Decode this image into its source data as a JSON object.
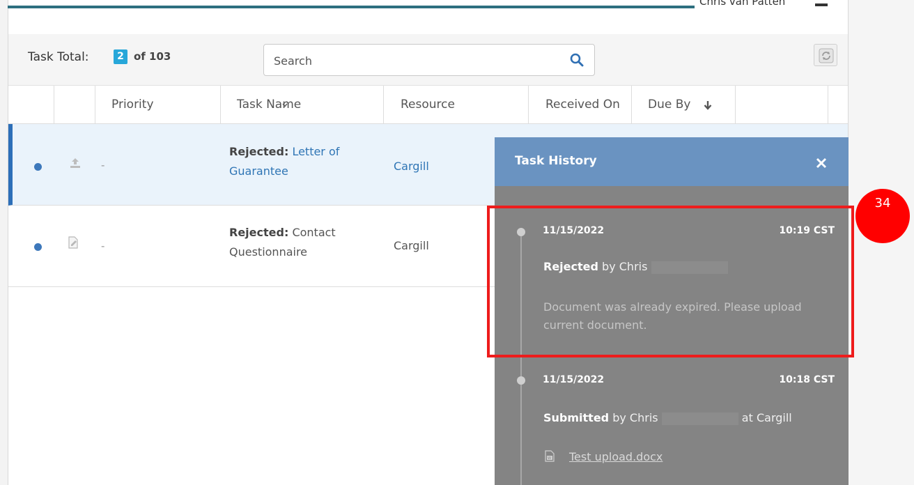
{
  "header": {
    "user_name": "Chris van Patten"
  },
  "toolbar": {
    "task_total_label": "Task Total:",
    "task_count": "2",
    "task_of_label": "of 103",
    "search_placeholder": "Search"
  },
  "table": {
    "columns": {
      "priority": "Priority",
      "task_name": "Task Name",
      "resource": "Resource",
      "received_on": "Received On",
      "due_by": "Due By"
    },
    "rows": [
      {
        "priority": "-",
        "status_label": "Rejected:",
        "task_title": "Letter of Guarantee",
        "resource": "Cargill",
        "icon": "upload-icon"
      },
      {
        "priority": "-",
        "status_label": "Rejected:",
        "task_title": "Contact Questionnaire",
        "resource": "Cargill",
        "icon": "document-edit-icon"
      }
    ]
  },
  "task_history": {
    "title": "Task History",
    "entries": [
      {
        "date": "11/15/2022",
        "time": "10:19 CST",
        "action": "Rejected",
        "by_text": "by Chris",
        "comment": "Document was already expired.  Please upload current document."
      },
      {
        "date": "11/15/2022",
        "time": "10:18 CST",
        "action": "Submitted",
        "by_text": "by Chris",
        "at_text": "at Cargill",
        "file_name": "Test upload.docx"
      }
    ]
  },
  "annotation": {
    "step_number": "34"
  },
  "colors": {
    "accent_blue": "#2f75b5",
    "badge_blue": "#27a7d9",
    "panel_header": "#6a93c1",
    "panel_body": "#848484",
    "highlight_red": "#ee1c1c"
  }
}
